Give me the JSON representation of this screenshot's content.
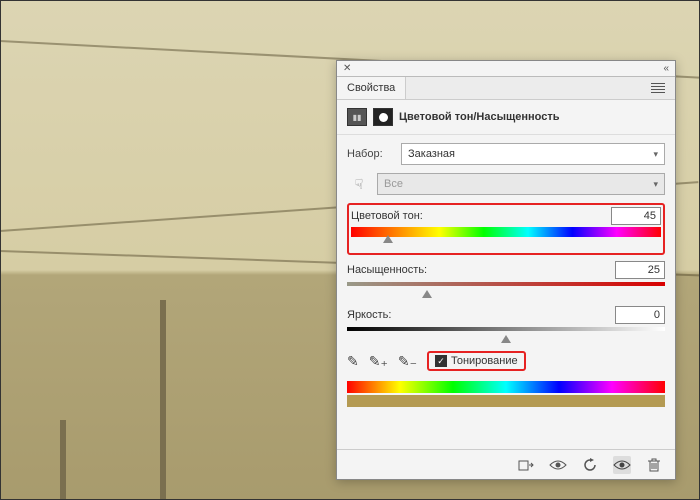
{
  "panel": {
    "tab": "Свойства",
    "title": "Цветовой тон/Насыщенность",
    "preset_label": "Набор:",
    "preset_value": "Заказная",
    "range_value": "Все",
    "hue": {
      "label": "Цветовой тон:",
      "value": "45"
    },
    "sat": {
      "label": "Насыщенность:",
      "value": "25"
    },
    "bri": {
      "label": "Яркость:",
      "value": "0"
    },
    "colorize": "Тонирование"
  }
}
